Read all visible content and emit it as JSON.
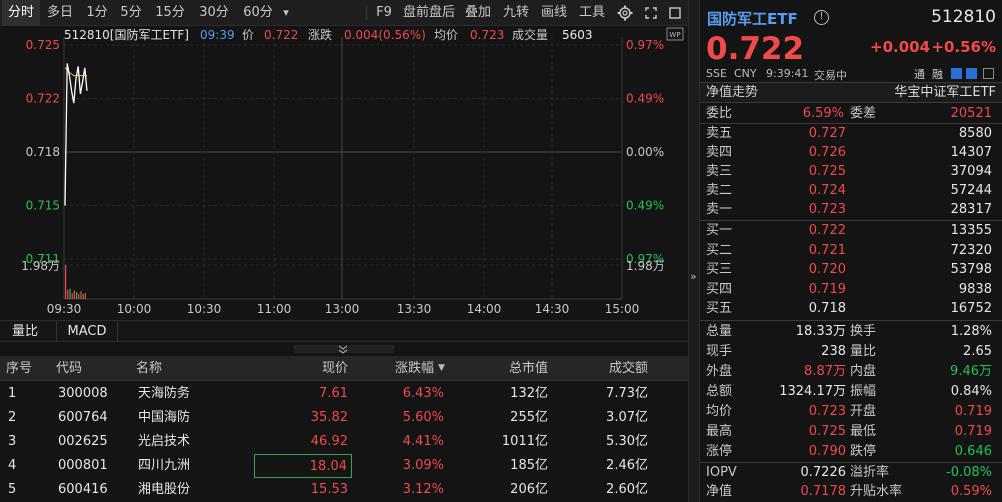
{
  "toolbar": {
    "tabs": [
      "分时",
      "多日",
      "1分",
      "5分",
      "15分",
      "30分",
      "60分"
    ],
    "more": "▾",
    "right": [
      "F9",
      "盘前盘后",
      "叠加",
      "九转",
      "画线",
      "工具"
    ]
  },
  "chart": {
    "info": {
      "code": "512810[国防军工ETF]",
      "time": "09:39",
      "price_label": "价",
      "price": "0.722",
      "change_label": "涨跌",
      "change": "0.004(0.56%)",
      "avg_label": "均价",
      "avg": "0.723",
      "vol_label": "成交量",
      "vol": "5603"
    },
    "wp_label": "WP",
    "y_left": [
      "0.725",
      "0.722",
      "0.718",
      "0.715",
      "0.711"
    ],
    "y_right": [
      "0.97%",
      "0.49%",
      "0.00%",
      "0.49%",
      "0.97%"
    ],
    "vol_left": "1.98万",
    "vol_right": "1.98万",
    "x_ticks": [
      "09:30",
      "10:00",
      "10:30",
      "11:00",
      "13:00",
      "13:30",
      "14:00",
      "14:30",
      "15:00"
    ],
    "price_min": 0.711,
    "price_max": 0.725,
    "prev_close": 0.718,
    "points": [
      0.7145,
      0.7238,
      0.723,
      0.722,
      0.7212,
      0.7228,
      0.7236,
      0.7218,
      0.7226,
      0.7235,
      0.722
    ],
    "avg_points": [
      0.7235,
      0.7234,
      0.7232,
      0.7231,
      0.723,
      0.723,
      0.723,
      0.723,
      0.723,
      0.723,
      0.723
    ],
    "vol_bars": [
      1.98,
      0.55,
      0.6,
      0.35,
      0.5,
      0.4,
      0.3,
      0.45,
      0.3,
      0.35
    ],
    "vol_max": 1.98,
    "colors": {
      "price": "#ffffff",
      "avg": "#f0c040",
      "up": "#f04a4a",
      "down": "#22c35a",
      "grid": "#2a2a2a"
    }
  },
  "indicator_tabs": [
    "量比",
    "MACD"
  ],
  "table": {
    "headers": [
      "序号",
      "代码",
      "名称",
      "现价",
      "涨跌幅",
      "总市值",
      "成交额"
    ],
    "sort_icon": "▼",
    "rows": [
      {
        "no": "1",
        "code": "300008",
        "name": "天海防务",
        "price": "7.61",
        "pct": "6.43%",
        "cap": "132亿",
        "amount": "7.73亿"
      },
      {
        "no": "2",
        "code": "600764",
        "name": "中国海防",
        "price": "35.82",
        "pct": "5.60%",
        "cap": "255亿",
        "amount": "3.07亿"
      },
      {
        "no": "3",
        "code": "002625",
        "name": "光启技术",
        "price": "46.92",
        "pct": "4.41%",
        "cap": "1011亿",
        "amount": "5.30亿"
      },
      {
        "no": "4",
        "code": "000801",
        "name": "四川九洲",
        "price": "18.04",
        "pct": "3.09%",
        "cap": "185亿",
        "amount": "2.46亿"
      },
      {
        "no": "5",
        "code": "600416",
        "name": "湘电股份",
        "price": "15.53",
        "pct": "3.12%",
        "cap": "206亿",
        "amount": "2.60亿"
      }
    ]
  },
  "quote": {
    "name": "国防军工ETF",
    "code": "512810",
    "price": "0.722",
    "change": "+0.004",
    "pct": "+0.56%",
    "exchange": "SSE",
    "currency": "CNY",
    "time": "9:39:41",
    "status": "交易中",
    "badge1": "通",
    "badge2": "融",
    "nav_trend": "净值走势",
    "index_name": "华宝中证军工ETF",
    "webi_label": "委比",
    "webi": "6.59%",
    "wecha_label": "委差",
    "wecha": "20521",
    "asks": [
      {
        "label": "卖五",
        "price": "0.727",
        "vol": "8580"
      },
      {
        "label": "卖四",
        "price": "0.726",
        "vol": "14307"
      },
      {
        "label": "卖三",
        "price": "0.725",
        "vol": "37094"
      },
      {
        "label": "卖二",
        "price": "0.724",
        "vol": "57244"
      },
      {
        "label": "卖一",
        "price": "0.723",
        "vol": "28317"
      }
    ],
    "bids": [
      {
        "label": "买一",
        "price": "0.722",
        "vol": "13355"
      },
      {
        "label": "买二",
        "price": "0.721",
        "vol": "72320"
      },
      {
        "label": "买三",
        "price": "0.720",
        "vol": "53798"
      },
      {
        "label": "买四",
        "price": "0.719",
        "vol": "9838"
      },
      {
        "label": "买五",
        "price": "0.718",
        "vol": "16752"
      }
    ],
    "stats": [
      {
        "l1": "总量",
        "v1": "18.33万",
        "l2": "换手",
        "v2": "1.28%"
      },
      {
        "l1": "现手",
        "v1": "238",
        "l2": "量比",
        "v2": "2.65"
      },
      {
        "l1": "外盘",
        "v1": "8.87万",
        "l2": "内盘",
        "v2": "9.46万"
      },
      {
        "l1": "总额",
        "v1": "1324.17万",
        "l2": "振幅",
        "v2": "0.84%"
      },
      {
        "l1": "均价",
        "v1": "0.723",
        "l2": "开盘",
        "v2": "0.719"
      },
      {
        "l1": "最高",
        "v1": "0.725",
        "l2": "最低",
        "v2": "0.719"
      },
      {
        "l1": "涨停",
        "v1": "0.790",
        "l2": "跌停",
        "v2": "0.646"
      }
    ],
    "extra": [
      {
        "l1": "IOPV",
        "v1": "0.7226",
        "l2": "溢折率",
        "v2": "-0.08%"
      },
      {
        "l1": "净值",
        "v1": "0.7178",
        "l2": "升贴水率",
        "v2": "0.59%"
      }
    ]
  }
}
